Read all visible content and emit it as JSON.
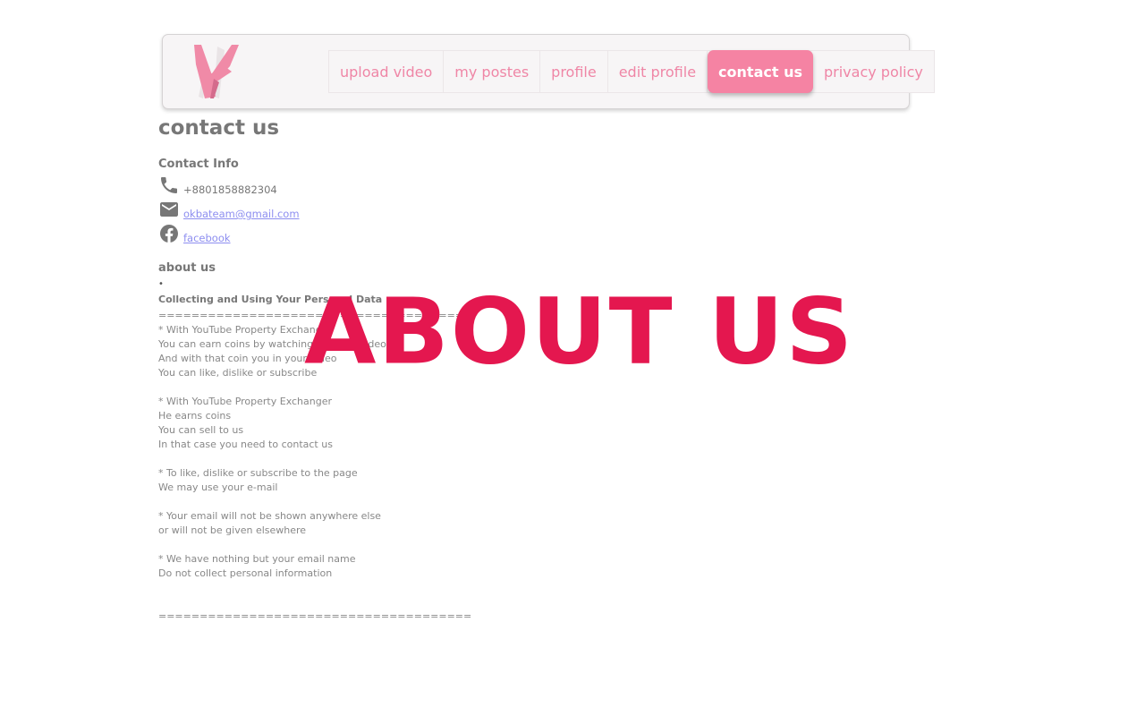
{
  "nav": {
    "items": [
      {
        "label": "upload video",
        "active": false
      },
      {
        "label": "my postes",
        "active": false
      },
      {
        "label": "profile",
        "active": false
      },
      {
        "label": "edit profile",
        "active": false
      },
      {
        "label": "contact us",
        "active": true
      },
      {
        "label": "privacy policy",
        "active": false
      }
    ]
  },
  "page": {
    "title": "contact us"
  },
  "contact_info": {
    "heading": "Contact Info",
    "phone": "+8801858882304",
    "email": "okbateam@gmail.com",
    "facebook": "facebook"
  },
  "about": {
    "heading": "about us",
    "bullet": "•",
    "policy_title": "Collecting and Using Your Personal Data",
    "policy_text": "======================================\n* With YouTube Property Exchanger\nYou can earn coins by watching YouTube videos\nAnd with that coin you in your video\nYou can like, dislike or subscribe\n\n* With YouTube Property Exchanger\nHe earns coins\nYou can sell to us\nIn that case you need to contact us\n\n* To like, dislike or subscribe to the page\nWe may use your e-mail\n\n* Your email will not be shown anywhere else\nor will not be given elsewhere\n\n* We have nothing but your email name\nDo not collect personal information\n\n\n======================================",
    "overlay_text": "ABOUT US"
  },
  "colors": {
    "accent": "#f583a3",
    "nav_text": "#ef86a6",
    "overlay": "#e4174f",
    "link": "#8d8ef0",
    "text": "#777777"
  },
  "icons": {
    "logo": "logo-icon",
    "phone": "phone-icon",
    "email": "mail-icon",
    "facebook": "facebook-icon"
  }
}
